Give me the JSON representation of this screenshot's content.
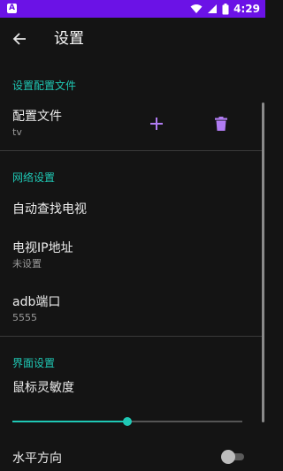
{
  "status_bar": {
    "badge": "A",
    "time": "4:29",
    "icons": [
      "wifi-icon",
      "signal-icon",
      "battery-icon"
    ],
    "color": "#6b12e6"
  },
  "app_bar": {
    "title": "设置",
    "back_icon": "arrow-left-icon"
  },
  "accent_color": "#1fc8b5",
  "sections": {
    "profile": {
      "header": "设置配置文件",
      "item": {
        "title": "配置文件",
        "summary": "tv"
      },
      "add_icon": "plus-icon",
      "delete_icon": "trash-icon",
      "icon_color": "#b07cf2"
    },
    "network": {
      "header": "网络设置",
      "auto_find": {
        "title": "自动查找电视"
      },
      "tv_ip": {
        "title": "电视IP地址",
        "summary": "未设置"
      },
      "adb_port": {
        "title": "adb端口",
        "summary": "5555"
      }
    },
    "ui": {
      "header": "界面设置",
      "mouse_sensitivity": {
        "title": "鼠标灵敏度",
        "level": 0.5
      },
      "horizontal": {
        "title": "水平方向",
        "enabled": false
      }
    }
  }
}
